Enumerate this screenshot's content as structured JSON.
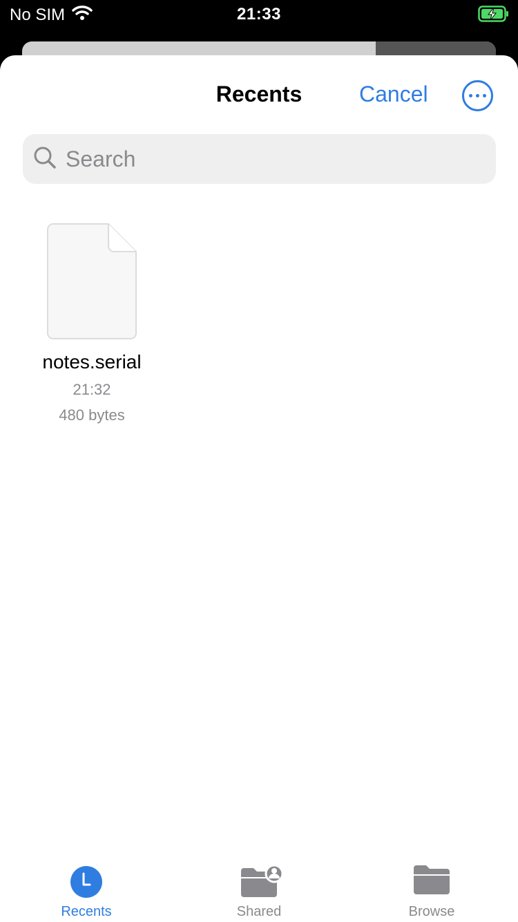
{
  "status_bar": {
    "carrier": "No SIM",
    "time": "21:33",
    "battery_state": "charging"
  },
  "header": {
    "title": "Recents",
    "cancel_label": "Cancel",
    "more_icon": "ellipsis-circle-icon"
  },
  "search": {
    "placeholder": "Search",
    "value": ""
  },
  "files": [
    {
      "name": "notes.serial",
      "time": "21:32",
      "size": "480 bytes",
      "icon": "document-icon"
    }
  ],
  "tabs": [
    {
      "label": "Recents",
      "icon": "clock-icon",
      "active": true
    },
    {
      "label": "Shared",
      "icon": "shared-folder-icon",
      "active": false
    },
    {
      "label": "Browse",
      "icon": "folder-icon",
      "active": false
    }
  ],
  "colors": {
    "accent": "#2f7de1",
    "secondary_text": "#8a8a8e",
    "search_bg": "#efefef",
    "battery_fill": "#4cd964"
  }
}
